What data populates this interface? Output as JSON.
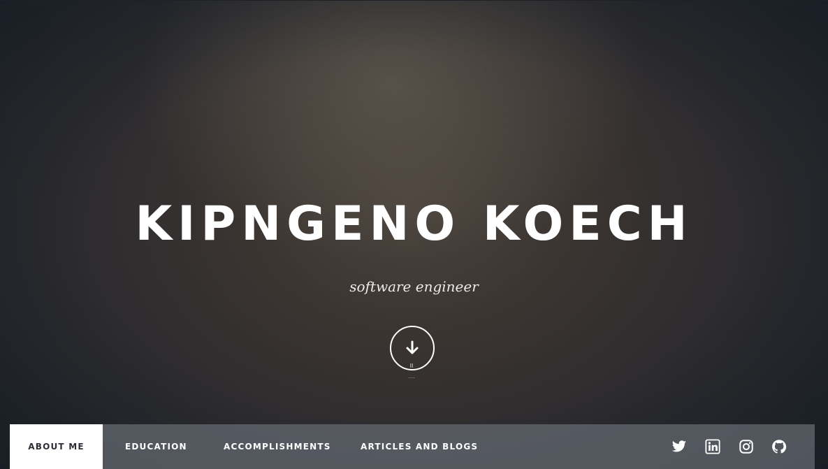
{
  "hero": {
    "name": "KIPNGENO KOECH",
    "subtitle": "software engineer",
    "scroll_hint": "II",
    "scroll_dots": "....."
  },
  "nav": {
    "items": [
      {
        "label": "ABOUT ME",
        "active": true
      },
      {
        "label": "EDUCATION",
        "active": false
      },
      {
        "label": "ACCOMPLISHMENTS",
        "active": false
      },
      {
        "label": "ARTICLES AND BLOGS",
        "active": false
      }
    ],
    "social": [
      {
        "icon": "twitter-icon"
      },
      {
        "icon": "linkedin-icon"
      },
      {
        "icon": "instagram-icon"
      },
      {
        "icon": "github-icon"
      }
    ]
  },
  "colors": {
    "nav_active_bg": "#ffffff",
    "nav_active_text": "#2b2f35",
    "nav_bg": "#62666e",
    "text": "#ffffff"
  }
}
